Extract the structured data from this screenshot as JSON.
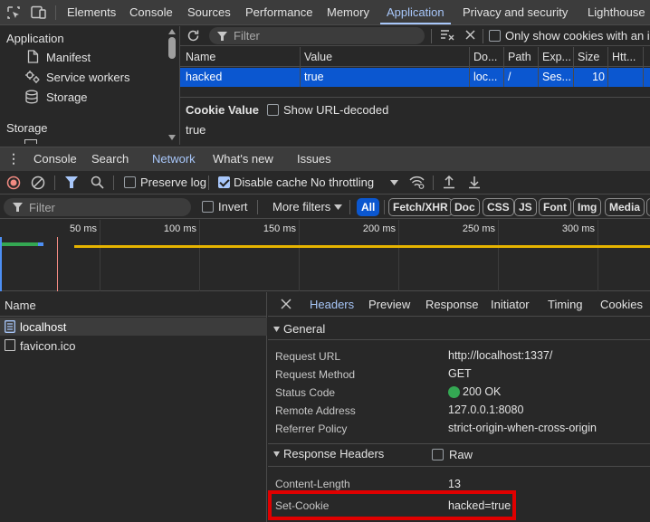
{
  "top_tabs": {
    "elements": "Elements",
    "console": "Console",
    "sources": "Sources",
    "performance": "Performance",
    "memory": "Memory",
    "application": "Application",
    "privacy": "Privacy and security",
    "lighthouse": "Lighthouse"
  },
  "sidebar": {
    "application_header": "Application",
    "manifest": "Manifest",
    "service_workers": "Service workers",
    "storage_item": "Storage",
    "storage_header": "Storage"
  },
  "cookies": {
    "filter_placeholder": "Filter",
    "only_issues_label": "Only show cookies with an issu",
    "columns": [
      "Name",
      "Value",
      "Do...",
      "Path",
      "Exp...",
      "Size",
      "Htt..."
    ],
    "row": {
      "name": "hacked",
      "value": "true",
      "domain": "loc...",
      "path": "/",
      "expires": "Ses...",
      "size": "10",
      "httponly": ""
    },
    "cookie_value_title": "Cookie Value",
    "show_url_decoded": "Show URL-decoded",
    "cookie_value": "true"
  },
  "drawer": {
    "console": "Console",
    "search": "Search",
    "network": "Network",
    "whats_new": "What's new",
    "issues": "Issues"
  },
  "network_toolbar": {
    "preserve_log": "Preserve log",
    "disable_cache": "Disable cache",
    "throttling": "No throttling"
  },
  "filter_bar": {
    "placeholder": "Filter",
    "invert": "Invert",
    "more_filters": "More filters",
    "chips": [
      "All",
      "Fetch/XHR",
      "Doc",
      "CSS",
      "JS",
      "Font",
      "Img",
      "Media"
    ]
  },
  "timeline": {
    "ticks": [
      "50 ms",
      "100 ms",
      "150 ms",
      "200 ms",
      "250 ms",
      "300 ms"
    ]
  },
  "requests": {
    "header": "Name",
    "items": [
      "localhost",
      "favicon.ico"
    ]
  },
  "detail_tabs": {
    "headers": "Headers",
    "preview": "Preview",
    "response": "Response",
    "initiator": "Initiator",
    "timing": "Timing",
    "cookies": "Cookies"
  },
  "general": {
    "title": "General",
    "request_url_label": "Request URL",
    "request_url": "http://localhost:1337/",
    "request_method_label": "Request Method",
    "request_method": "GET",
    "status_code_label": "Status Code",
    "status_code": "200 OK",
    "remote_address_label": "Remote Address",
    "remote_address": "127.0.0.1:8080",
    "referrer_policy_label": "Referrer Policy",
    "referrer_policy": "strict-origin-when-cross-origin"
  },
  "response_headers": {
    "title": "Response Headers",
    "raw_label": "Raw",
    "content_length_label": "Content-Length",
    "content_length": "13",
    "set_cookie_label": "Set-Cookie",
    "set_cookie": "hacked=true"
  },
  "colors": {
    "accent": "#a8c7fa",
    "selected_row": "#0b57d0",
    "status_ok": "#34a853",
    "highlight_box": "#e00000",
    "record_stop": "#f28b82",
    "timeline_bar": "#e6b400"
  }
}
